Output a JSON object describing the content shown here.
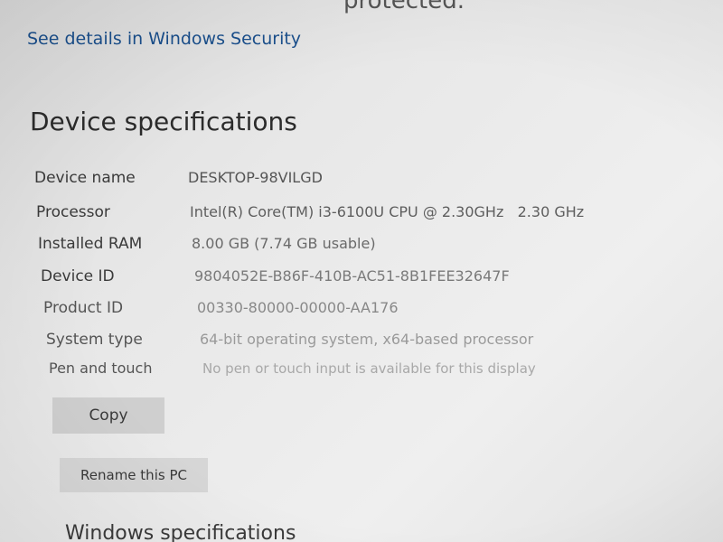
{
  "top_cropped_text": "protected.",
  "security_link": "See details in Windows Security",
  "device_specs": {
    "title": "Device specifications",
    "rows": [
      {
        "label": "Device name",
        "value": "DESKTOP-98VILGD"
      },
      {
        "label": "Processor",
        "value": "Intel(R) Core(TM) i3-6100U CPU @ 2.30GHz   2.30 GHz"
      },
      {
        "label": "Installed RAM",
        "value": "8.00 GB (7.74 GB usable)"
      },
      {
        "label": "Device ID",
        "value": "9804052E-B86F-410B-AC51-8B1FEE32647F"
      },
      {
        "label": "Product ID",
        "value": "00330-80000-00000-AA176"
      },
      {
        "label": "System type",
        "value": "64-bit operating system, x64-based processor"
      },
      {
        "label": "Pen and touch",
        "value": "No pen or touch input is available for this display"
      }
    ],
    "copy_button": "Copy",
    "rename_button": "Rename this PC"
  },
  "next_section_title": "Windows specifications"
}
